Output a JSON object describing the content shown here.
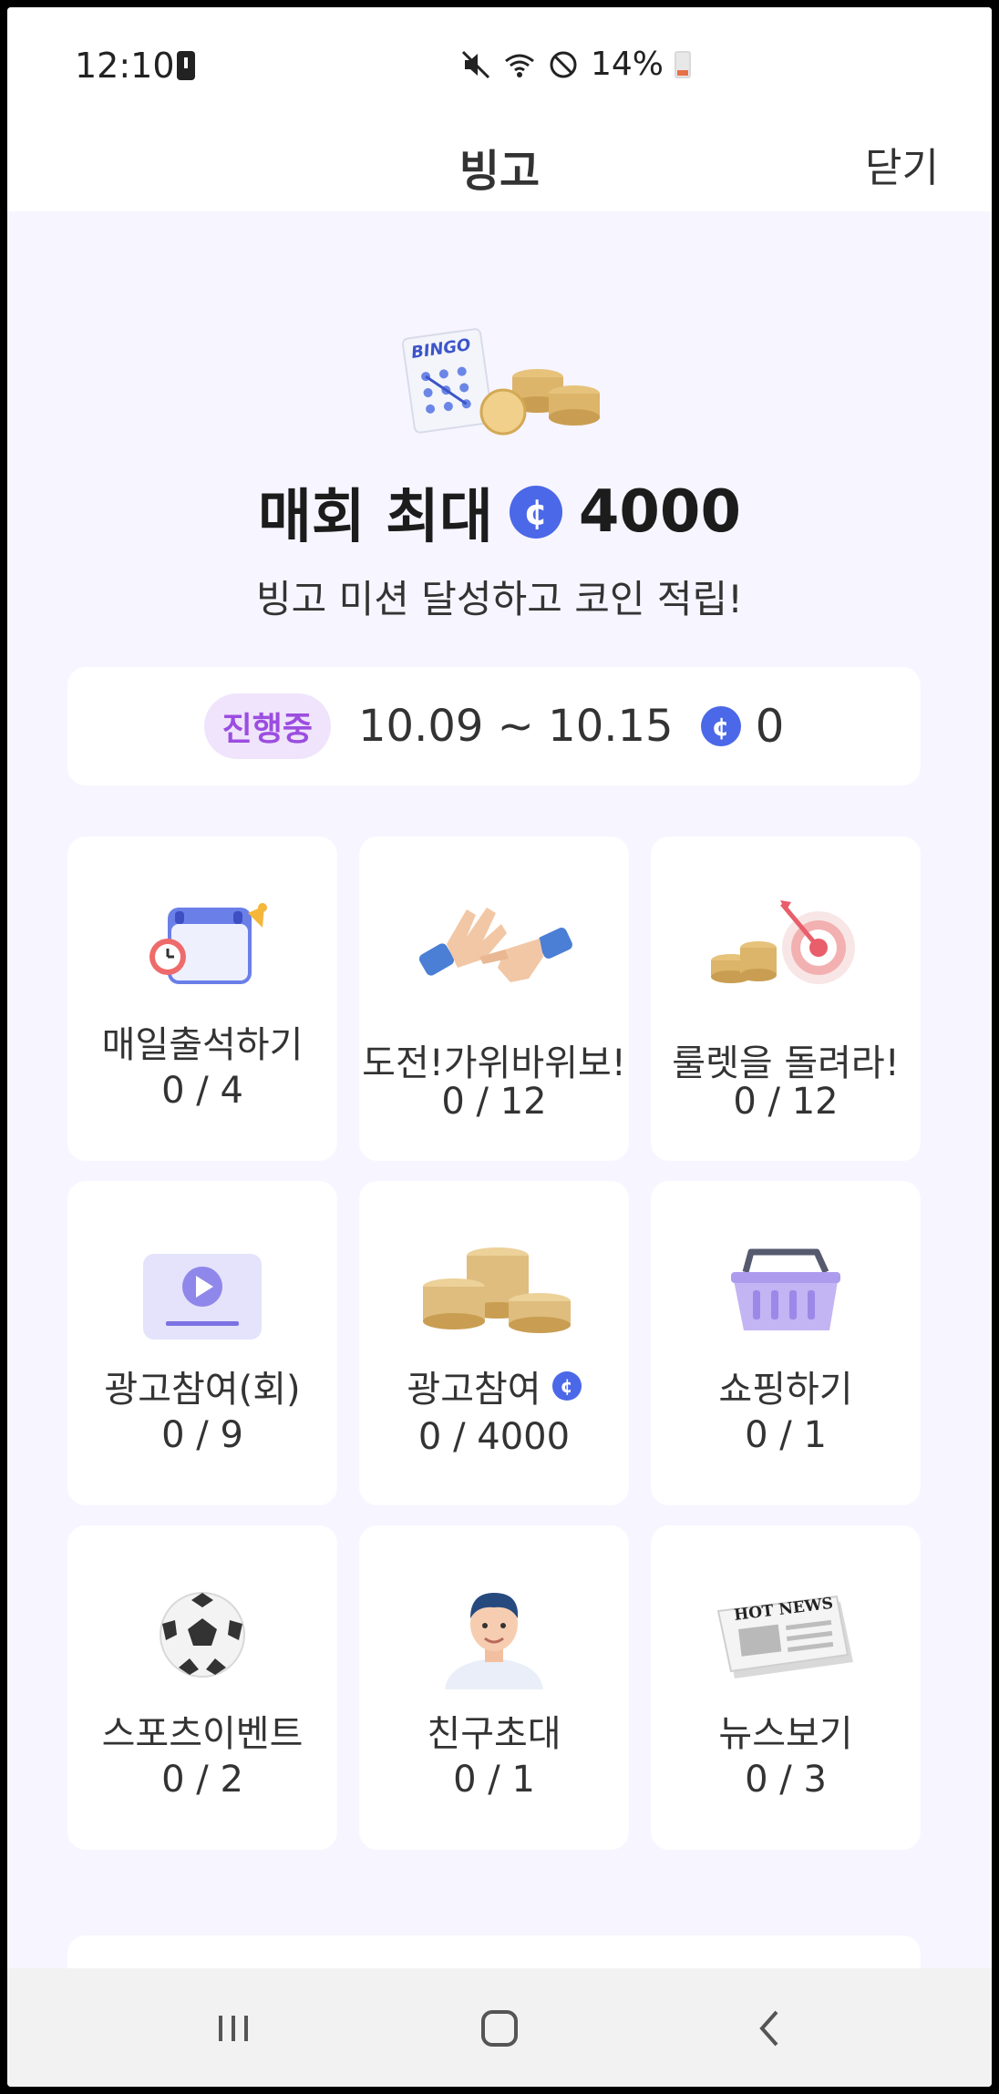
{
  "status": {
    "time": "12:10",
    "battery": "14%"
  },
  "header": {
    "title": "빙고",
    "close_label": "닫기"
  },
  "hero": {
    "image_text": "BINGO",
    "title_prefix": "매회 최대",
    "title_amount": "4000",
    "subtitle": "빙고 미션 달성하고 코인 적립!"
  },
  "period": {
    "badge": "진행중",
    "range": "10.09 ~ 10.15",
    "coins": "0"
  },
  "coin_symbol": "¢",
  "missions": [
    {
      "label": "매일출석하기",
      "progress": "0 / 4",
      "icon": "calendar-alarm-icon"
    },
    {
      "label": "도전!가위바위보!",
      "progress": "0 / 12",
      "icon": "rock-paper-scissors-icon"
    },
    {
      "label": "룰렛을 돌려라!",
      "progress": "0 / 12",
      "icon": "dart-target-icon"
    },
    {
      "label": "광고참여(회)",
      "progress": "0 / 9",
      "icon": "video-play-icon"
    },
    {
      "label": "광고참여",
      "progress": "0 / 4000",
      "icon": "coin-stacks-icon"
    },
    {
      "label": "쇼핑하기",
      "progress": "0 / 1",
      "icon": "shopping-basket-icon"
    },
    {
      "label": "스포츠이벤트",
      "progress": "0 / 2",
      "icon": "soccer-ball-icon"
    },
    {
      "label": "친구초대",
      "progress": "0 / 1",
      "icon": "person-avatar-icon"
    },
    {
      "label": "뉴스보기",
      "progress": "0 / 3",
      "icon": "newspaper-icon",
      "image_text": "HOT NEWS"
    }
  ],
  "colors": {
    "accent": "#4b68e8",
    "badge_bg": "#efe4fb",
    "badge_text": "#9b4de0",
    "page_bg": "#f7f5ff"
  }
}
